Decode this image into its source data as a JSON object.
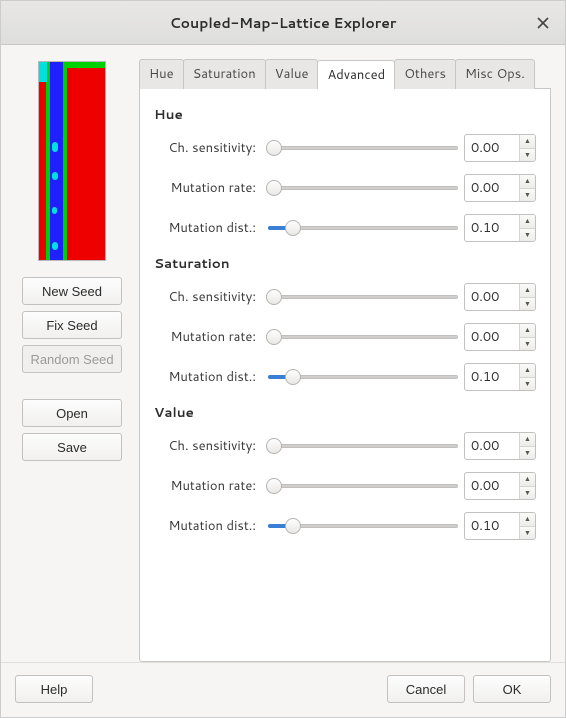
{
  "window": {
    "title": "Coupled-Map-Lattice Explorer"
  },
  "sidebar": {
    "buttons": {
      "new_seed": "New Seed",
      "fix_seed": "Fix Seed",
      "random_seed": "Random Seed",
      "open": "Open",
      "save": "Save"
    }
  },
  "tabs": [
    "Hue",
    "Saturation",
    "Value",
    "Advanced",
    "Others",
    "Misc Ops."
  ],
  "active_tab": "Advanced",
  "sections": [
    {
      "title": "Hue",
      "rows": [
        {
          "label": "Ch. sensitivity:",
          "value": "0.00",
          "pos": 0
        },
        {
          "label": "Mutation rate:",
          "value": "0.00",
          "pos": 0
        },
        {
          "label": "Mutation dist.:",
          "value": "0.10",
          "pos": 10
        }
      ]
    },
    {
      "title": "Saturation",
      "rows": [
        {
          "label": "Ch. sensitivity:",
          "value": "0.00",
          "pos": 0
        },
        {
          "label": "Mutation rate:",
          "value": "0.00",
          "pos": 0
        },
        {
          "label": "Mutation dist.:",
          "value": "0.10",
          "pos": 10
        }
      ]
    },
    {
      "title": "Value",
      "rows": [
        {
          "label": "Ch. sensitivity:",
          "value": "0.00",
          "pos": 0
        },
        {
          "label": "Mutation rate:",
          "value": "0.00",
          "pos": 0
        },
        {
          "label": "Mutation dist.:",
          "value": "0.10",
          "pos": 10
        }
      ]
    }
  ],
  "footer": {
    "help": "Help",
    "cancel": "Cancel",
    "ok": "OK"
  }
}
